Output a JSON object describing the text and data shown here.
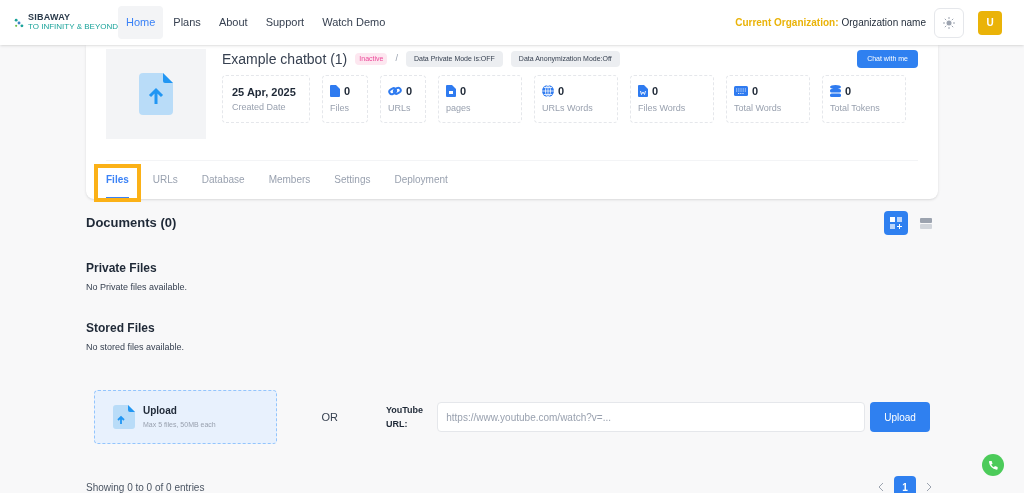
{
  "nav": {
    "logo": "SIBAWAY",
    "logo_tagline": "TO INFINITY & BEYOND",
    "items": [
      {
        "label": "Home",
        "selected": true
      },
      {
        "label": "Plans",
        "selected": false
      },
      {
        "label": "About",
        "selected": false
      },
      {
        "label": "Support",
        "selected": false
      },
      {
        "label": "Watch Demo",
        "selected": false
      }
    ],
    "org_label": "Current Organization:",
    "org_name": "Organization name",
    "avatar": "U"
  },
  "bot": {
    "title": "Example chatbot (1)",
    "status": "Inactive",
    "separator": "/",
    "badges": [
      "Data Private Mode is:OFF",
      "Data Anonymization Mode:Off"
    ],
    "chat_button": "Chat with me",
    "stats": [
      {
        "kind": "date",
        "value": "25 Apr, 2025",
        "label": "Created Date"
      },
      {
        "kind": "file",
        "value": "0",
        "label": "Files"
      },
      {
        "kind": "link",
        "value": "0",
        "label": "URLs"
      },
      {
        "kind": "page",
        "value": "0",
        "label": "pages"
      },
      {
        "kind": "globe",
        "value": "0",
        "label": "URLs Words"
      },
      {
        "kind": "word",
        "value": "0",
        "label": "Files Words"
      },
      {
        "kind": "keyboard",
        "value": "0",
        "label": "Total Words"
      },
      {
        "kind": "database",
        "value": "0",
        "label": "Total Tokens"
      }
    ]
  },
  "tabs": [
    {
      "label": "Files",
      "selected": true,
      "highlighted": true
    },
    {
      "label": "URLs",
      "selected": false,
      "highlighted": false
    },
    {
      "label": "Database",
      "selected": false,
      "highlighted": false
    },
    {
      "label": "Members",
      "selected": false,
      "highlighted": false
    },
    {
      "label": "Settings",
      "selected": false,
      "highlighted": false
    },
    {
      "label": "Deployment",
      "selected": false,
      "highlighted": false
    }
  ],
  "documents_title": "Documents (0)",
  "views": [
    {
      "kind": "grid",
      "selected": true
    },
    {
      "kind": "list",
      "selected": false
    }
  ],
  "sections": [
    {
      "title": "Private Files",
      "empty": "No Private files available."
    },
    {
      "title": "Stored Files",
      "empty": "No stored files available."
    }
  ],
  "upload": {
    "title": "Upload",
    "hint": "Max 5 files, 50MB each",
    "or": "OR",
    "youtube_label": "YouTube URL:",
    "placeholder": "https://www.youtube.com/watch?v=...",
    "button": "Upload"
  },
  "footer": {
    "entries": "Showing 0 to 0 of 0 entries",
    "pages": [
      {
        "label": "1",
        "selected": true
      }
    ]
  }
}
